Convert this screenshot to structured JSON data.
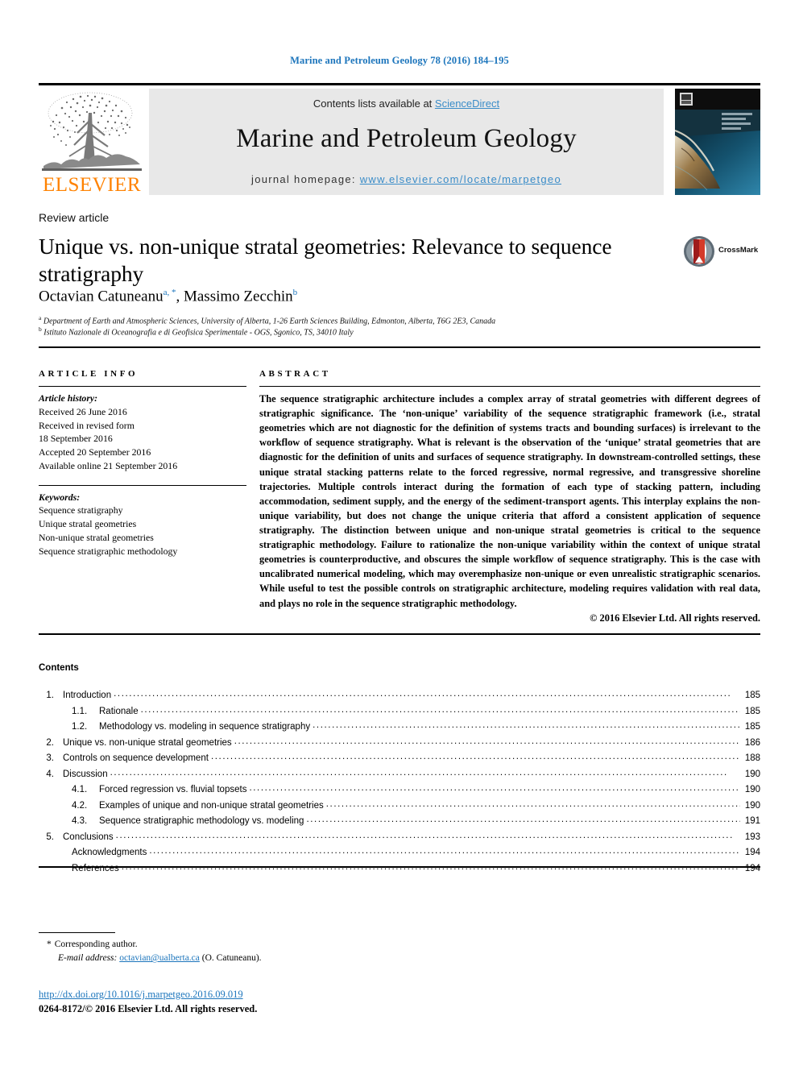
{
  "running_head": "Marine and Petroleum Geology 78 (2016) 184–195",
  "masthead": {
    "publisher_logo_text": "ELSEVIER",
    "contents_prefix": "Contents lists available at ",
    "contents_link": "ScienceDirect",
    "journal_title": "Marine and Petroleum Geology",
    "homepage_prefix": "journal homepage: ",
    "homepage_url": "www.elsevier.com/locate/marpetgeo",
    "cover_alt": "journal-cover-satellite-coastline"
  },
  "article": {
    "type": "Review article",
    "title": "Unique vs. non-unique stratal geometries: Relevance to sequence stratigraphy",
    "crossmark_label": "CrossMark",
    "authors": [
      {
        "name": "Octavian Catuneanu",
        "marks": "a, *"
      },
      {
        "name": "Massimo Zecchin",
        "marks": "b"
      }
    ],
    "affiliations": [
      {
        "mark": "a",
        "text": "Department of Earth and Atmospheric Sciences, University of Alberta, 1-26 Earth Sciences Building, Edmonton, Alberta, T6G 2E3, Canada"
      },
      {
        "mark": "b",
        "text": "Istituto Nazionale di Oceanografia e di Geofisica Sperimentale - OGS, Sgonico, TS, 34010 Italy"
      }
    ]
  },
  "article_info": {
    "heading": "ARTICLE INFO",
    "history_label": "Article history:",
    "history": [
      "Received 26 June 2016",
      "Received in revised form",
      "18 September 2016",
      "Accepted 20 September 2016",
      "Available online 21 September 2016"
    ],
    "keywords_label": "Keywords:",
    "keywords": [
      "Sequence stratigraphy",
      "Unique stratal geometries",
      "Non-unique stratal geometries",
      "Sequence stratigraphic methodology"
    ]
  },
  "abstract": {
    "heading": "ABSTRACT",
    "text": "The sequence stratigraphic architecture includes a complex array of stratal geometries with different degrees of stratigraphic significance. The ‘non-unique’ variability of the sequence stratigraphic framework (i.e., stratal geometries which are not diagnostic for the definition of systems tracts and bounding surfaces) is irrelevant to the workflow of sequence stratigraphy. What is relevant is the observation of the ‘unique’ stratal geometries that are diagnostic for the definition of units and surfaces of sequence stratigraphy. In downstream-controlled settings, these unique stratal stacking patterns relate to the forced regressive, normal regressive, and transgressive shoreline trajectories. Multiple controls interact during the formation of each type of stacking pattern, including accommodation, sediment supply, and the energy of the sediment-transport agents. This interplay explains the non-unique variability, but does not change the unique criteria that afford a consistent application of sequence stratigraphy. The distinction between unique and non-unique stratal geometries is critical to the sequence stratigraphic methodology. Failure to rationalize the non-unique variability within the context of unique stratal geometries is counterproductive, and obscures the simple workflow of sequence stratigraphy. This is the case with uncalibrated numerical modeling, which may overemphasize non-unique or even unrealistic stratigraphic scenarios. While useful to test the possible controls on stratigraphic architecture, modeling requires validation with real data, and plays no role in the sequence stratigraphic methodology.",
    "copyright": "© 2016 Elsevier Ltd. All rights reserved."
  },
  "contents": {
    "heading": "Contents",
    "entries": [
      {
        "num": "1.",
        "label": "Introduction",
        "page": "185",
        "level": 1
      },
      {
        "num": "1.1.",
        "label": "Rationale",
        "page": "185",
        "level": 2
      },
      {
        "num": "1.2.",
        "label": "Methodology vs. modeling in sequence stratigraphy",
        "page": "185",
        "level": 2
      },
      {
        "num": "2.",
        "label": "Unique vs. non-unique stratal geometries",
        "page": "186",
        "level": 1
      },
      {
        "num": "3.",
        "label": "Controls on sequence development",
        "page": "188",
        "level": 1
      },
      {
        "num": "4.",
        "label": "Discussion",
        "page": "190",
        "level": 1
      },
      {
        "num": "4.1.",
        "label": "Forced regression vs. fluvial topsets",
        "page": "190",
        "level": 2
      },
      {
        "num": "4.2.",
        "label": "Examples of unique and non-unique stratal geometries",
        "page": "190",
        "level": 2
      },
      {
        "num": "4.3.",
        "label": "Sequence stratigraphic methodology vs. modeling",
        "page": "191",
        "level": 2
      },
      {
        "num": "5.",
        "label": "Conclusions",
        "page": "193",
        "level": 1
      },
      {
        "num": "",
        "label": "Acknowledgments",
        "page": "194",
        "level": 3
      },
      {
        "num": "",
        "label": "References",
        "page": "194",
        "level": 3
      }
    ]
  },
  "footer": {
    "corresponding_marker": "*",
    "corresponding_text": "Corresponding author.",
    "email_label": "E-mail address:",
    "email": "octavian@ualberta.ca",
    "email_suffix": "(O. Catuneanu).",
    "doi": "http://dx.doi.org/10.1016/j.marpetgeo.2016.09.019",
    "issn_line": "0264-8172/© 2016 Elsevier Ltd. All rights reserved."
  },
  "colors": {
    "link_blue": "#1c75bc",
    "sd_blue": "#3a8cc8",
    "elsevier_orange": "#ff8200",
    "band_gray": "#e8e8e8"
  }
}
